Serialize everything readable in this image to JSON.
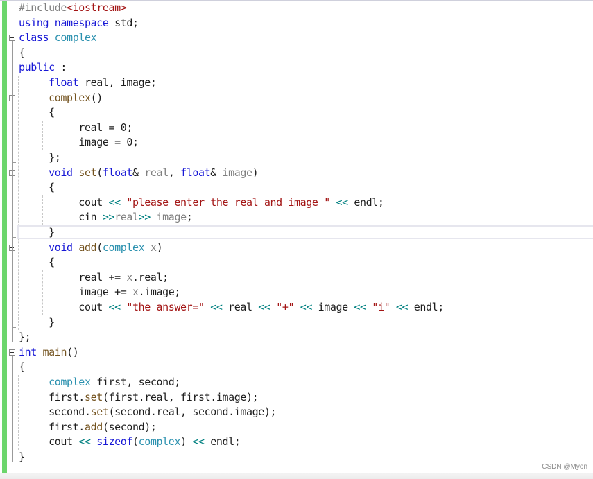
{
  "editor": {
    "lines": [
      {
        "tokens": [
          {
            "t": "#include",
            "c": "pp"
          },
          {
            "t": "<iostream>",
            "c": "inc"
          }
        ]
      },
      {
        "tokens": [
          {
            "t": "using",
            "c": "kw"
          },
          {
            "t": " ",
            "c": ""
          },
          {
            "t": "namespace",
            "c": "kw"
          },
          {
            "t": " std;",
            "c": ""
          }
        ]
      },
      {
        "tokens": [
          {
            "t": "class",
            "c": "kw"
          },
          {
            "t": " ",
            "c": ""
          },
          {
            "t": "complex",
            "c": "ty"
          }
        ]
      },
      {
        "tokens": [
          {
            "t": "{",
            "c": ""
          }
        ]
      },
      {
        "tokens": [
          {
            "t": "public",
            "c": "kw"
          },
          {
            "t": " :",
            "c": ""
          }
        ]
      },
      {
        "tokens": [
          {
            "t": "     ",
            "c": ""
          },
          {
            "t": "float",
            "c": "kw"
          },
          {
            "t": " real, image;",
            "c": ""
          }
        ]
      },
      {
        "tokens": [
          {
            "t": "     ",
            "c": ""
          },
          {
            "t": "complex",
            "c": "fn"
          },
          {
            "t": "()",
            "c": ""
          }
        ]
      },
      {
        "tokens": [
          {
            "t": "     {",
            "c": ""
          }
        ]
      },
      {
        "tokens": [
          {
            "t": "          real = 0;",
            "c": ""
          }
        ]
      },
      {
        "tokens": [
          {
            "t": "          image = 0;",
            "c": ""
          }
        ]
      },
      {
        "tokens": [
          {
            "t": "     };",
            "c": ""
          }
        ]
      },
      {
        "tokens": [
          {
            "t": "     ",
            "c": ""
          },
          {
            "t": "void",
            "c": "kw"
          },
          {
            "t": " ",
            "c": ""
          },
          {
            "t": "set",
            "c": "fn"
          },
          {
            "t": "(",
            "c": ""
          },
          {
            "t": "float",
            "c": "kw"
          },
          {
            "t": "& ",
            "c": ""
          },
          {
            "t": "real",
            "c": "pm"
          },
          {
            "t": ", ",
            "c": ""
          },
          {
            "t": "float",
            "c": "kw"
          },
          {
            "t": "& ",
            "c": ""
          },
          {
            "t": "image",
            "c": "pm"
          },
          {
            "t": ")",
            "c": ""
          }
        ]
      },
      {
        "tokens": [
          {
            "t": "     {",
            "c": ""
          }
        ]
      },
      {
        "tokens": [
          {
            "t": "          cout ",
            "c": ""
          },
          {
            "t": "<<",
            "c": "op"
          },
          {
            "t": " ",
            "c": ""
          },
          {
            "t": "\"please enter the real and image \"",
            "c": "str"
          },
          {
            "t": " ",
            "c": ""
          },
          {
            "t": "<<",
            "c": "op"
          },
          {
            "t": " endl;",
            "c": ""
          }
        ]
      },
      {
        "tokens": [
          {
            "t": "          cin ",
            "c": ""
          },
          {
            "t": ">>",
            "c": "op"
          },
          {
            "t": "real",
            "c": "pm"
          },
          {
            "t": ">>",
            "c": "op"
          },
          {
            "t": " ",
            "c": ""
          },
          {
            "t": "image",
            "c": "pm"
          },
          {
            "t": ";",
            "c": ""
          }
        ]
      },
      {
        "tokens": [
          {
            "t": "     }",
            "c": ""
          }
        ]
      },
      {
        "tokens": [
          {
            "t": "     ",
            "c": ""
          },
          {
            "t": "void",
            "c": "kw"
          },
          {
            "t": " ",
            "c": ""
          },
          {
            "t": "add",
            "c": "fn"
          },
          {
            "t": "(",
            "c": ""
          },
          {
            "t": "complex",
            "c": "ty"
          },
          {
            "t": " ",
            "c": ""
          },
          {
            "t": "x",
            "c": "pm"
          },
          {
            "t": ")",
            "c": ""
          }
        ]
      },
      {
        "tokens": [
          {
            "t": "     {",
            "c": ""
          }
        ]
      },
      {
        "tokens": [
          {
            "t": "          real += ",
            "c": ""
          },
          {
            "t": "x",
            "c": "pm"
          },
          {
            "t": ".real;",
            "c": ""
          }
        ]
      },
      {
        "tokens": [
          {
            "t": "          image += ",
            "c": ""
          },
          {
            "t": "x",
            "c": "pm"
          },
          {
            "t": ".image;",
            "c": ""
          }
        ]
      },
      {
        "tokens": [
          {
            "t": "          cout ",
            "c": ""
          },
          {
            "t": "<<",
            "c": "op"
          },
          {
            "t": " ",
            "c": ""
          },
          {
            "t": "\"the answer=\"",
            "c": "str"
          },
          {
            "t": " ",
            "c": ""
          },
          {
            "t": "<<",
            "c": "op"
          },
          {
            "t": " real ",
            "c": ""
          },
          {
            "t": "<<",
            "c": "op"
          },
          {
            "t": " ",
            "c": ""
          },
          {
            "t": "\"+\"",
            "c": "str"
          },
          {
            "t": " ",
            "c": ""
          },
          {
            "t": "<<",
            "c": "op"
          },
          {
            "t": " image ",
            "c": ""
          },
          {
            "t": "<<",
            "c": "op"
          },
          {
            "t": " ",
            "c": ""
          },
          {
            "t": "\"i\"",
            "c": "str"
          },
          {
            "t": " ",
            "c": ""
          },
          {
            "t": "<<",
            "c": "op"
          },
          {
            "t": " endl;",
            "c": ""
          }
        ]
      },
      {
        "tokens": [
          {
            "t": "     }",
            "c": ""
          }
        ]
      },
      {
        "tokens": [
          {
            "t": "};",
            "c": ""
          }
        ]
      },
      {
        "tokens": [
          {
            "t": "int",
            "c": "kw"
          },
          {
            "t": " ",
            "c": ""
          },
          {
            "t": "main",
            "c": "fn"
          },
          {
            "t": "()",
            "c": ""
          }
        ]
      },
      {
        "tokens": [
          {
            "t": "{",
            "c": ""
          }
        ]
      },
      {
        "tokens": [
          {
            "t": "     ",
            "c": ""
          },
          {
            "t": "complex",
            "c": "ty"
          },
          {
            "t": " first, second;",
            "c": ""
          }
        ]
      },
      {
        "tokens": [
          {
            "t": "     first.",
            "c": ""
          },
          {
            "t": "set",
            "c": "fn"
          },
          {
            "t": "(first.real, first.image);",
            "c": ""
          }
        ]
      },
      {
        "tokens": [
          {
            "t": "     second.",
            "c": ""
          },
          {
            "t": "set",
            "c": "fn"
          },
          {
            "t": "(second.real, second.image);",
            "c": ""
          }
        ]
      },
      {
        "tokens": [
          {
            "t": "     first.",
            "c": ""
          },
          {
            "t": "add",
            "c": "fn"
          },
          {
            "t": "(second);",
            "c": ""
          }
        ]
      },
      {
        "tokens": [
          {
            "t": "     cout ",
            "c": ""
          },
          {
            "t": "<<",
            "c": "op"
          },
          {
            "t": " ",
            "c": ""
          },
          {
            "t": "sizeof",
            "c": "kw"
          },
          {
            "t": "(",
            "c": ""
          },
          {
            "t": "complex",
            "c": "ty"
          },
          {
            "t": ") ",
            "c": ""
          },
          {
            "t": "<<",
            "c": "op"
          },
          {
            "t": " endl;",
            "c": ""
          }
        ]
      },
      {
        "tokens": [
          {
            "t": "}",
            "c": ""
          }
        ]
      }
    ],
    "fold_markers": [
      {
        "line": 2,
        "state": "expanded"
      },
      {
        "line": 6,
        "state": "expanded"
      },
      {
        "line": 11,
        "state": "expanded"
      },
      {
        "line": 16,
        "state": "expanded"
      },
      {
        "line": 23,
        "state": "expanded"
      }
    ],
    "current_line": 15
  },
  "watermark": "CSDN @Myon⁠"
}
